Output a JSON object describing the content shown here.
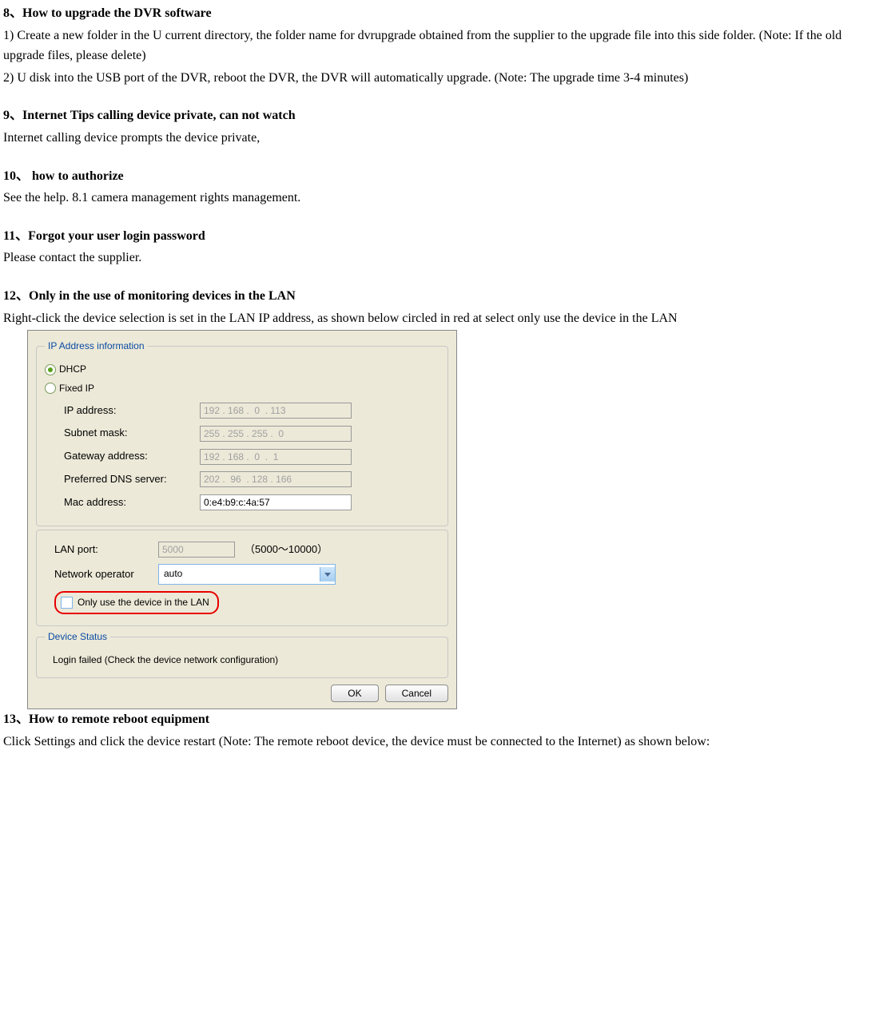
{
  "section8": {
    "title": "8、How to upgrade the DVR software",
    "p1": "1) Create a new folder in the U current directory, the folder name for dvrupgrade obtained from the supplier to the upgrade file into this side folder. (Note: If the old upgrade files, please delete)",
    "p2": "2) U disk into the USB port of the DVR, reboot the DVR, the DVR will automatically upgrade. (Note: The upgrade time 3-4 minutes)"
  },
  "section9": {
    "title": "9、Internet Tips calling device private, can not watch",
    "p1": "Internet calling device prompts the device private,"
  },
  "section10": {
    "title": "10、 how to authorize",
    "p1": "See the help. 8.1 camera management rights management."
  },
  "section11": {
    "title": "11、Forgot your user login password",
    "p1": "Please contact the supplier."
  },
  "section12": {
    "title": "12、Only in the use of monitoring devices in the LAN",
    "p1": "Right-click the device selection is set in the LAN IP address, as shown below circled in red at select only use the device in the LAN"
  },
  "dialog": {
    "ipinfo_legend": "IP Address information",
    "radio_dhcp": "DHCP",
    "radio_fixed": "Fixed IP",
    "labels": {
      "ip": "IP address:",
      "subnet": "Subnet mask:",
      "gateway": "Gateway address:",
      "dns": "Preferred DNS server:",
      "mac": "Mac address:",
      "lanport": "LAN port:",
      "netop": "Network operator"
    },
    "values": {
      "ip": "192 . 168 .  0  . 113",
      "subnet": "255 . 255 . 255 .  0",
      "gateway": "192 . 168 .  0  .  1",
      "dns": "202 .  96  . 128 . 166",
      "mac": "0:e4:b9:c:4a:57",
      "lanport": "5000",
      "range": "（5000～10000）",
      "netop": "auto"
    },
    "only_lan": "Only use the device in the LAN",
    "status_legend": "Device Status",
    "status_text": "Login failed (Check the device network configuration)",
    "ok": "OK",
    "cancel": "Cancel"
  },
  "section13": {
    "title": "13、How to remote reboot equipment",
    "p1": "Click Settings and click the device restart (Note: The remote reboot device, the device must be connected to the Internet) as shown below:"
  }
}
